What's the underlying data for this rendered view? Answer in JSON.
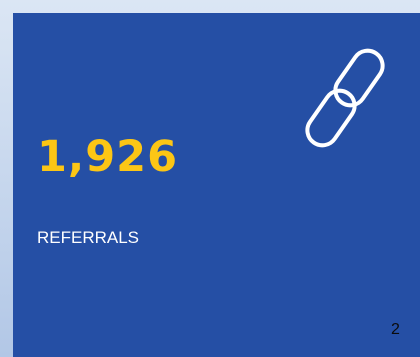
{
  "stat": {
    "value": "1,926",
    "label": "REFERRALS"
  },
  "icon": "link-icon",
  "page_number": "2",
  "colors": {
    "card_background": "#254fa5",
    "value_color": "#fcc615",
    "label_color": "#ffffff",
    "icon_color": "#ffffff"
  }
}
